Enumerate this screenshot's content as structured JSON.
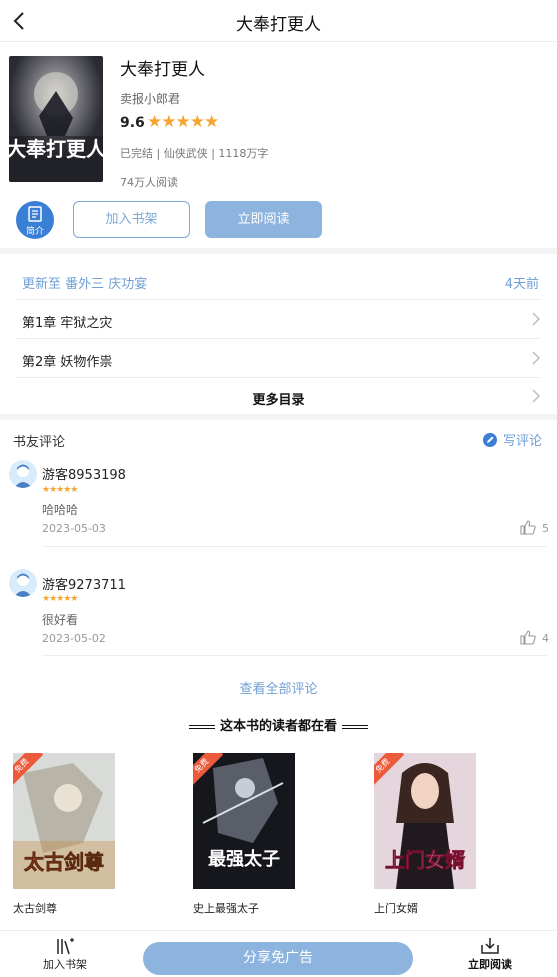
{
  "header": {
    "title": "大奉打更人"
  },
  "book": {
    "cover_text": "大奉打更人",
    "name": "大奉打更人",
    "author": "卖报小郎君",
    "score": "9.6",
    "rating_stars": 5,
    "meta": "已完结 | 仙侠武侠 | 1118万字",
    "readers": "74万人阅读"
  },
  "actions": {
    "intro_label": "简介",
    "add_shelf": "加入书架",
    "read_now": "立即阅读"
  },
  "chapters": {
    "update_text": "更新至 番外三 庆功宴",
    "update_time": "4天前",
    "items": [
      "第1章 牢狱之灾",
      "第2章 妖物作祟"
    ],
    "more": "更多目录"
  },
  "reviews": {
    "title": "书友评论",
    "write": "写评论",
    "items": [
      {
        "user": "游客8953198",
        "stars": 5,
        "text": "哈哈哈",
        "date": "2023-05-03",
        "likes": "5"
      },
      {
        "user": "游客9273711",
        "stars": 5,
        "text": "很好看",
        "date": "2023-05-02",
        "likes": "4"
      }
    ],
    "view_all": "查看全部评论"
  },
  "also_read": {
    "title": "这本书的读者都在看",
    "free_tag": "免费",
    "books": [
      {
        "title": "太古剑尊",
        "cover_text": "太古剑尊"
      },
      {
        "title": "史上最强太子",
        "cover_text": "最强太子"
      },
      {
        "title": "上门女婿",
        "cover_text": "上门女婿"
      }
    ]
  },
  "bottom": {
    "shelf": "加入书架",
    "share": "分享免广告",
    "read": "立即阅读"
  },
  "colors": {
    "accent": "#3a7fd6",
    "accent_light": "#8db4df",
    "link": "#6f9fd4",
    "star": "#f7a532"
  }
}
